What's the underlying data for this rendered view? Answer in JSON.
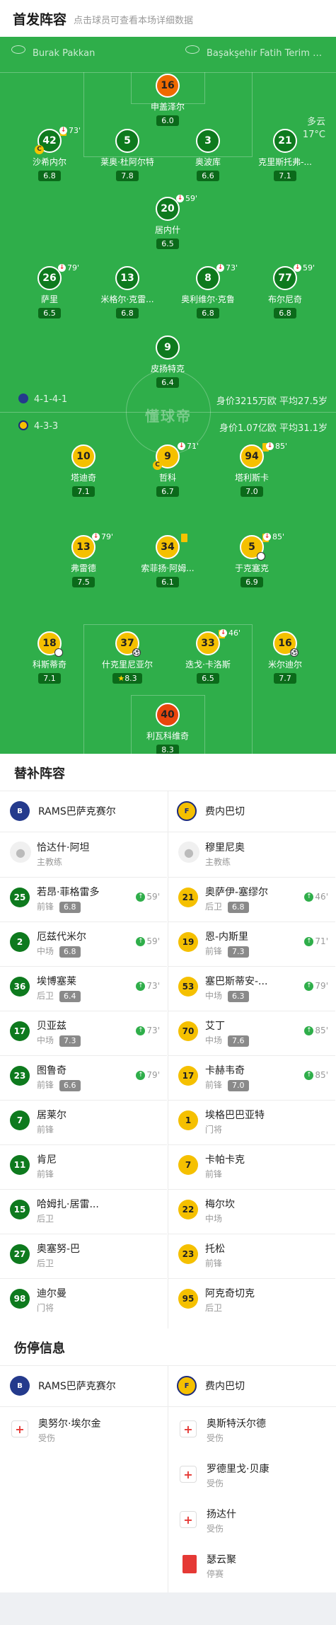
{
  "header": {
    "title": "首发阵容",
    "subtitle": "点击球员可查看本场详细数据"
  },
  "pitch_info": {
    "referee": "Burak Pakkan",
    "stadium": "Başakşehir Fatih Terim St...",
    "weather": "多云",
    "temperature": "17°C",
    "watermark": "懂球帝"
  },
  "home_team": {
    "name": "RAMS巴萨克赛尔",
    "formation": "4-1-4-1",
    "value": "身价3215万欧",
    "age": "平均27.5岁"
  },
  "away_team": {
    "name": "费内巴切",
    "formation": "4-3-3",
    "value": "身价1.07亿欧",
    "age": "平均31.1岁"
  },
  "home_players": [
    {
      "num": "16",
      "name": "申盖泽尔",
      "rating": "6.0"
    },
    {
      "num": "42",
      "name": "沙希内尔",
      "rating": "6.8",
      "sub": "73'"
    },
    {
      "num": "5",
      "name": "莱奥·杜阿尔特",
      "rating": "7.8"
    },
    {
      "num": "3",
      "name": "奥波库",
      "rating": "6.6"
    },
    {
      "num": "21",
      "name": "克里斯托弗-...",
      "rating": "7.1"
    },
    {
      "num": "20",
      "name": "居内什",
      "rating": "6.5",
      "sub": "59'"
    },
    {
      "num": "26",
      "name": "萨里",
      "rating": "6.5",
      "sub": "79'"
    },
    {
      "num": "13",
      "name": "米格尔·克雷...",
      "rating": "6.8"
    },
    {
      "num": "8",
      "name": "奥利维尔·克鲁",
      "rating": "6.8",
      "sub": "73'"
    },
    {
      "num": "77",
      "name": "布尔尼奇",
      "rating": "6.8",
      "sub": "59'"
    },
    {
      "num": "9",
      "name": "皮扬特克",
      "rating": "6.4"
    }
  ],
  "away_players": [
    {
      "num": "10",
      "name": "塔迪奇",
      "rating": "7.1"
    },
    {
      "num": "9",
      "name": "哲科",
      "rating": "6.7",
      "sub": "71'"
    },
    {
      "num": "94",
      "name": "塔利斯卡",
      "rating": "7.0",
      "sub": "85'"
    },
    {
      "num": "13",
      "name": "弗雷德",
      "rating": "7.5",
      "sub": "79'"
    },
    {
      "num": "34",
      "name": "索菲扬·阿姆...",
      "rating": "6.1"
    },
    {
      "num": "5",
      "name": "于克塞克",
      "rating": "6.9",
      "sub": "85'"
    },
    {
      "num": "18",
      "name": "科斯蒂奇",
      "rating": "7.1"
    },
    {
      "num": "37",
      "name": "什克里尼亚尔",
      "rating": "8.3"
    },
    {
      "num": "33",
      "name": "迭戈·卡洛斯",
      "rating": "6.5",
      "sub": "46'"
    },
    {
      "num": "16",
      "name": "米尔迪尔",
      "rating": "7.7"
    },
    {
      "num": "40",
      "name": "利瓦科维奇",
      "rating": "8.3"
    }
  ],
  "subs_section": {
    "title": "替补阵容",
    "coach_role": "主教练"
  },
  "home_subs": [
    {
      "num": "",
      "name": "恰达什·阿坦",
      "pos": "主教练"
    },
    {
      "num": "25",
      "name": "若昂·菲格雷多",
      "pos": "前锋",
      "rating": "6.8",
      "time": "59'"
    },
    {
      "num": "2",
      "name": "厄兹代米尔",
      "pos": "中场",
      "rating": "6.8",
      "time": "59'"
    },
    {
      "num": "36",
      "name": "埃博塞莱",
      "pos": "后卫",
      "rating": "6.4",
      "time": "73'"
    },
    {
      "num": "17",
      "name": "贝亚兹",
      "pos": "中场",
      "rating": "7.3",
      "time": "73'"
    },
    {
      "num": "23",
      "name": "图鲁奇",
      "pos": "前锋",
      "rating": "6.6",
      "time": "79'"
    },
    {
      "num": "7",
      "name": "居莱尔",
      "pos": "前锋"
    },
    {
      "num": "11",
      "name": "肯尼",
      "pos": "前锋"
    },
    {
      "num": "15",
      "name": "哈姆扎·居雷...",
      "pos": "后卫"
    },
    {
      "num": "27",
      "name": "奥塞努-巴",
      "pos": "后卫"
    },
    {
      "num": "98",
      "name": "迪尔曼",
      "pos": "门将"
    }
  ],
  "away_subs": [
    {
      "num": "",
      "name": "穆里尼奥",
      "pos": "主教练"
    },
    {
      "num": "21",
      "name": "奥萨伊-塞缪尔",
      "pos": "后卫",
      "rating": "6.8",
      "time": "46'"
    },
    {
      "num": "19",
      "name": "恩-内斯里",
      "pos": "前锋",
      "rating": "7.3",
      "time": "71'"
    },
    {
      "num": "53",
      "name": "塞巴斯蒂安-...",
      "pos": "中场",
      "rating": "6.3",
      "time": "79'"
    },
    {
      "num": "70",
      "name": "艾丁",
      "pos": "中场",
      "rating": "7.6",
      "time": "85'"
    },
    {
      "num": "17",
      "name": "卡赫韦奇",
      "pos": "前锋",
      "rating": "7.0",
      "time": "85'"
    },
    {
      "num": "1",
      "name": "埃格巴巴亚特",
      "pos": "门将"
    },
    {
      "num": "7",
      "name": "卡帕卡克",
      "pos": "前锋"
    },
    {
      "num": "22",
      "name": "梅尔坎",
      "pos": "中场"
    },
    {
      "num": "23",
      "name": "托松",
      "pos": "前锋"
    },
    {
      "num": "95",
      "name": "阿克奇切克",
      "pos": "后卫"
    }
  ],
  "injury_section": {
    "title": "伤停信息"
  },
  "home_injuries": [
    {
      "name": "奥努尔·埃尔金",
      "status": "受伤"
    }
  ],
  "away_injuries": [
    {
      "name": "奥斯特沃尔德",
      "status": "受伤"
    },
    {
      "name": "罗德里戈·贝康",
      "status": "受伤"
    },
    {
      "name": "扬达什",
      "status": "受伤"
    },
    {
      "name": "瑟云聚",
      "status": "停赛"
    }
  ],
  "colors": {
    "pitch": "#2fae4a",
    "home": "#0e7a1e",
    "away": "#f5c000",
    "gk_home": "#ee6a00"
  }
}
